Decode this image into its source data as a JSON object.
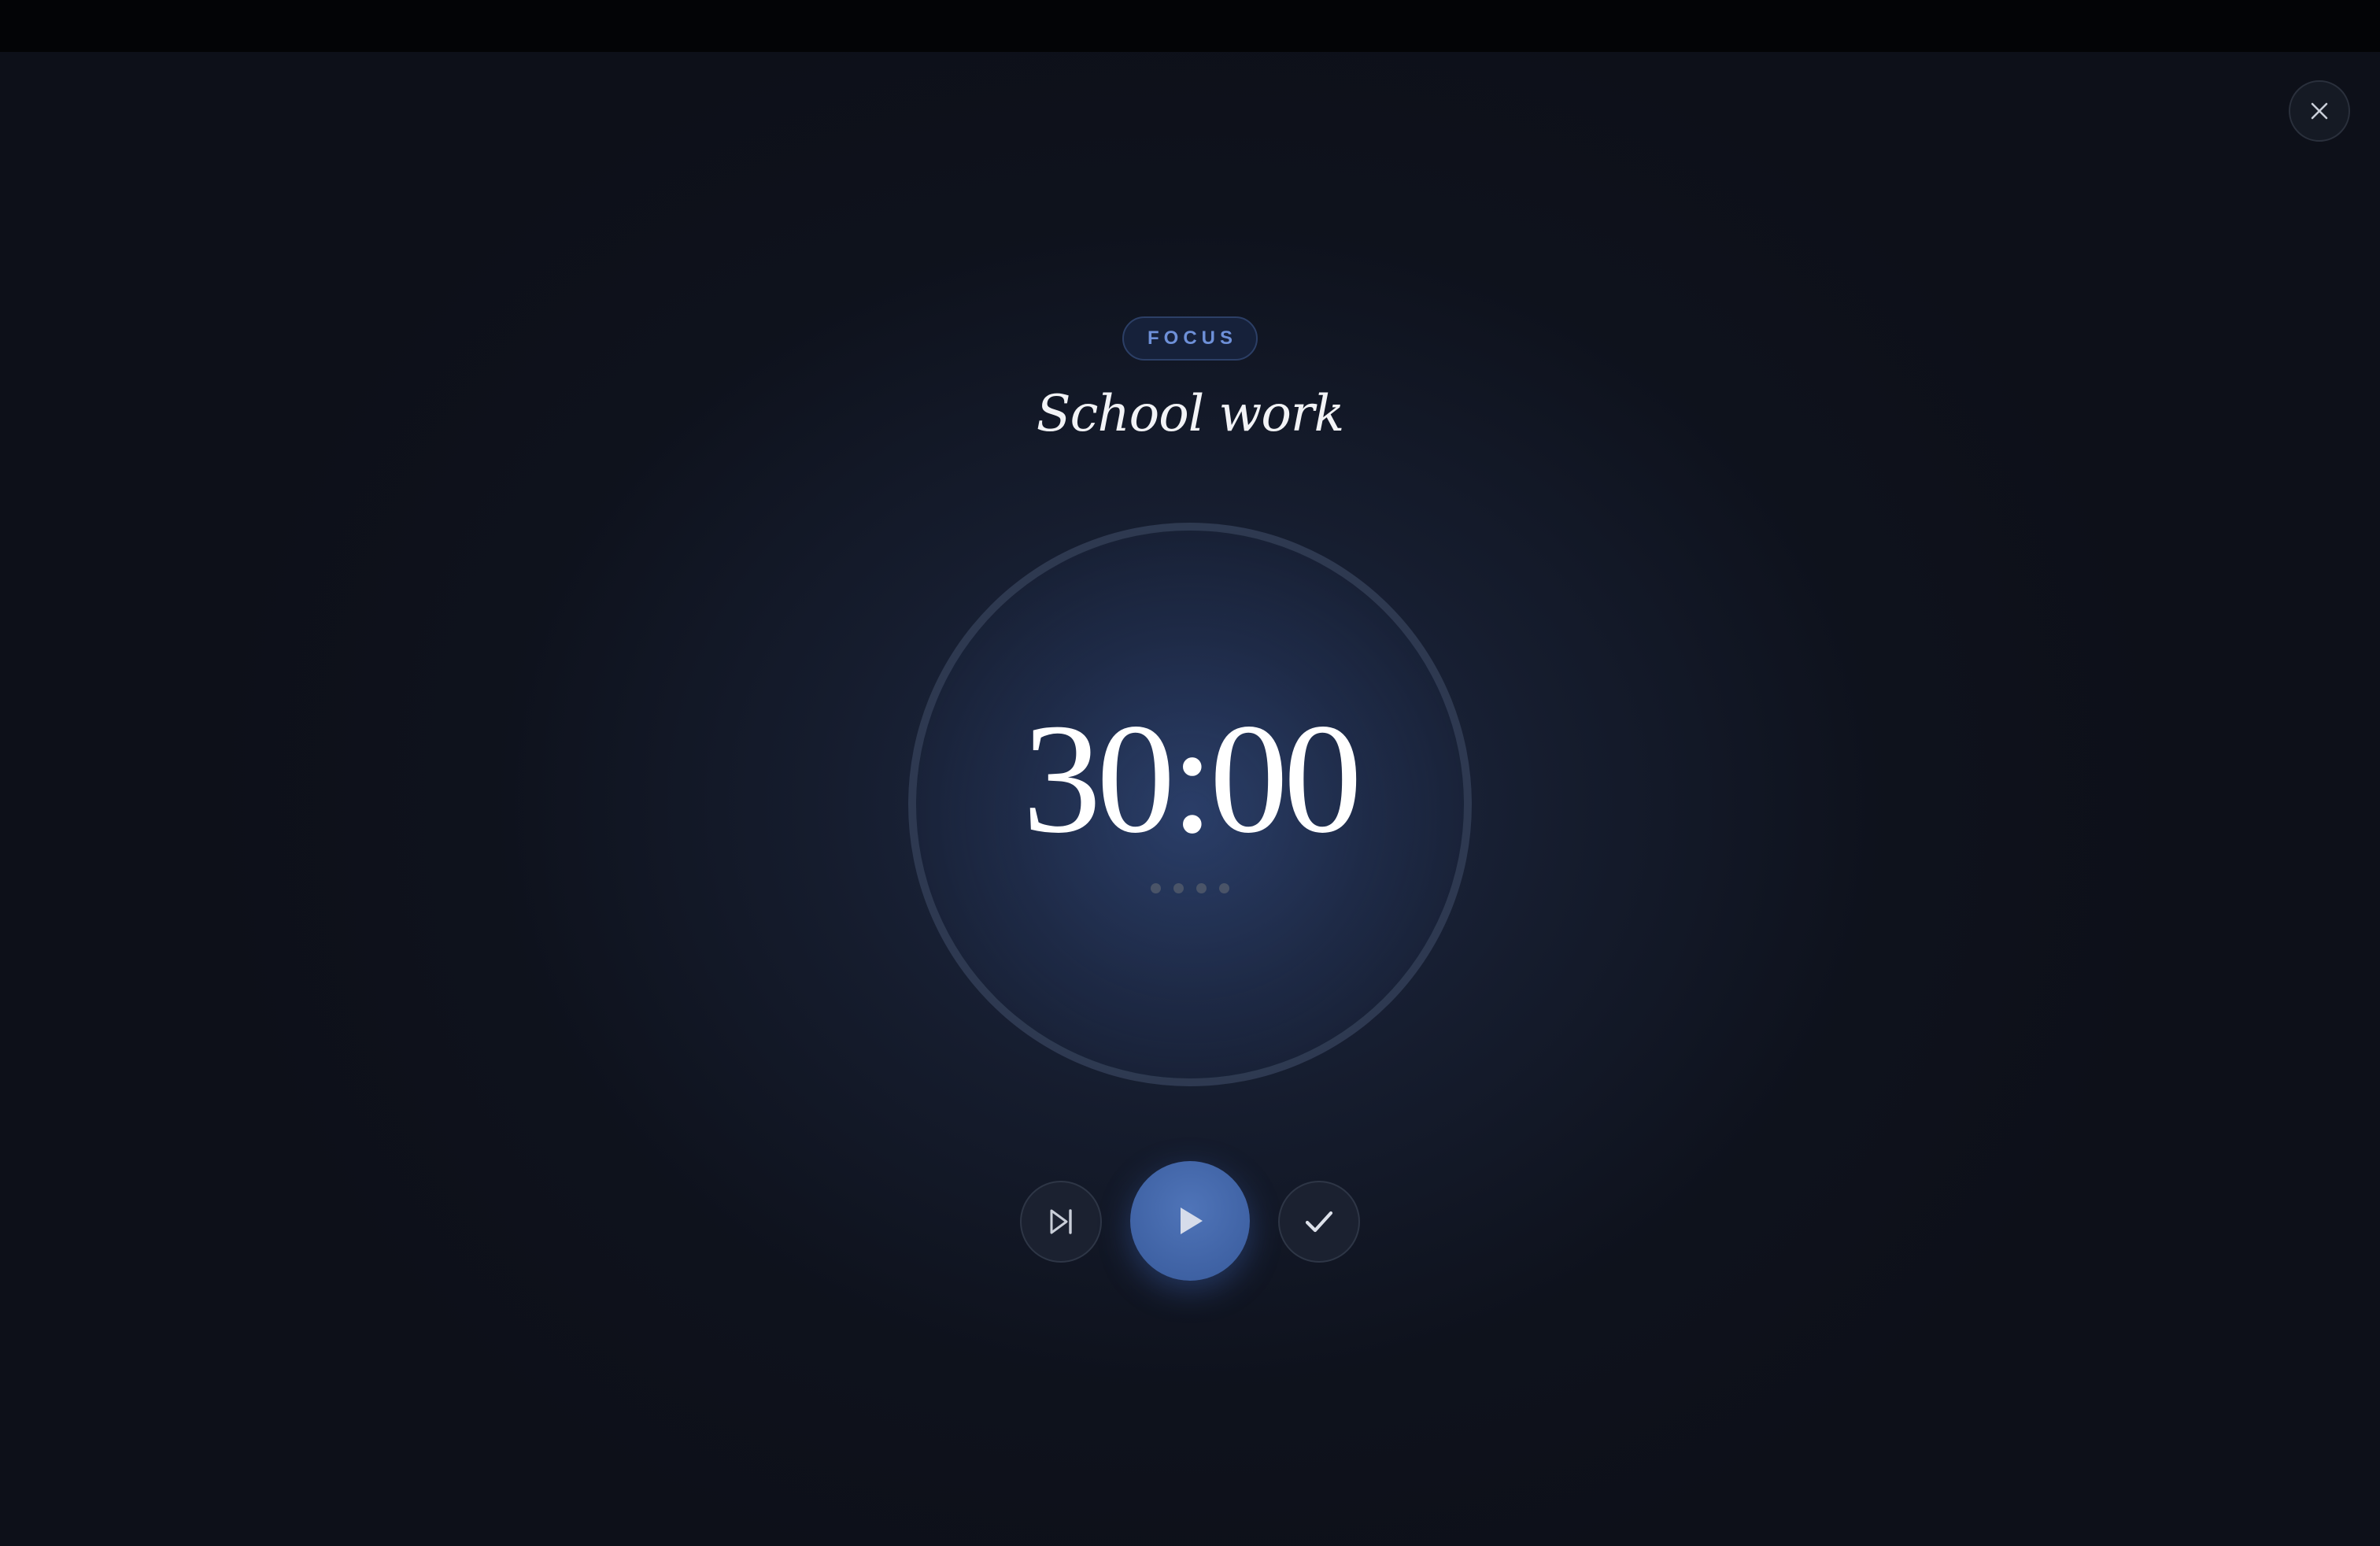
{
  "session": {
    "mode_label": "FOCUS",
    "task_title": "School work"
  },
  "timer": {
    "display": "30:00",
    "session_dots": [
      {
        "state": "pending"
      },
      {
        "state": "pending"
      },
      {
        "state": "pending"
      },
      {
        "state": "pending"
      }
    ]
  },
  "controls": {
    "skip_icon": "skip-forward-icon",
    "play_icon": "play-icon",
    "done_icon": "checkmark-icon",
    "close_icon": "close-icon"
  },
  "colors": {
    "accent": "#4a6db0",
    "badge_text": "#6e90d8",
    "background": "#0d1019"
  }
}
